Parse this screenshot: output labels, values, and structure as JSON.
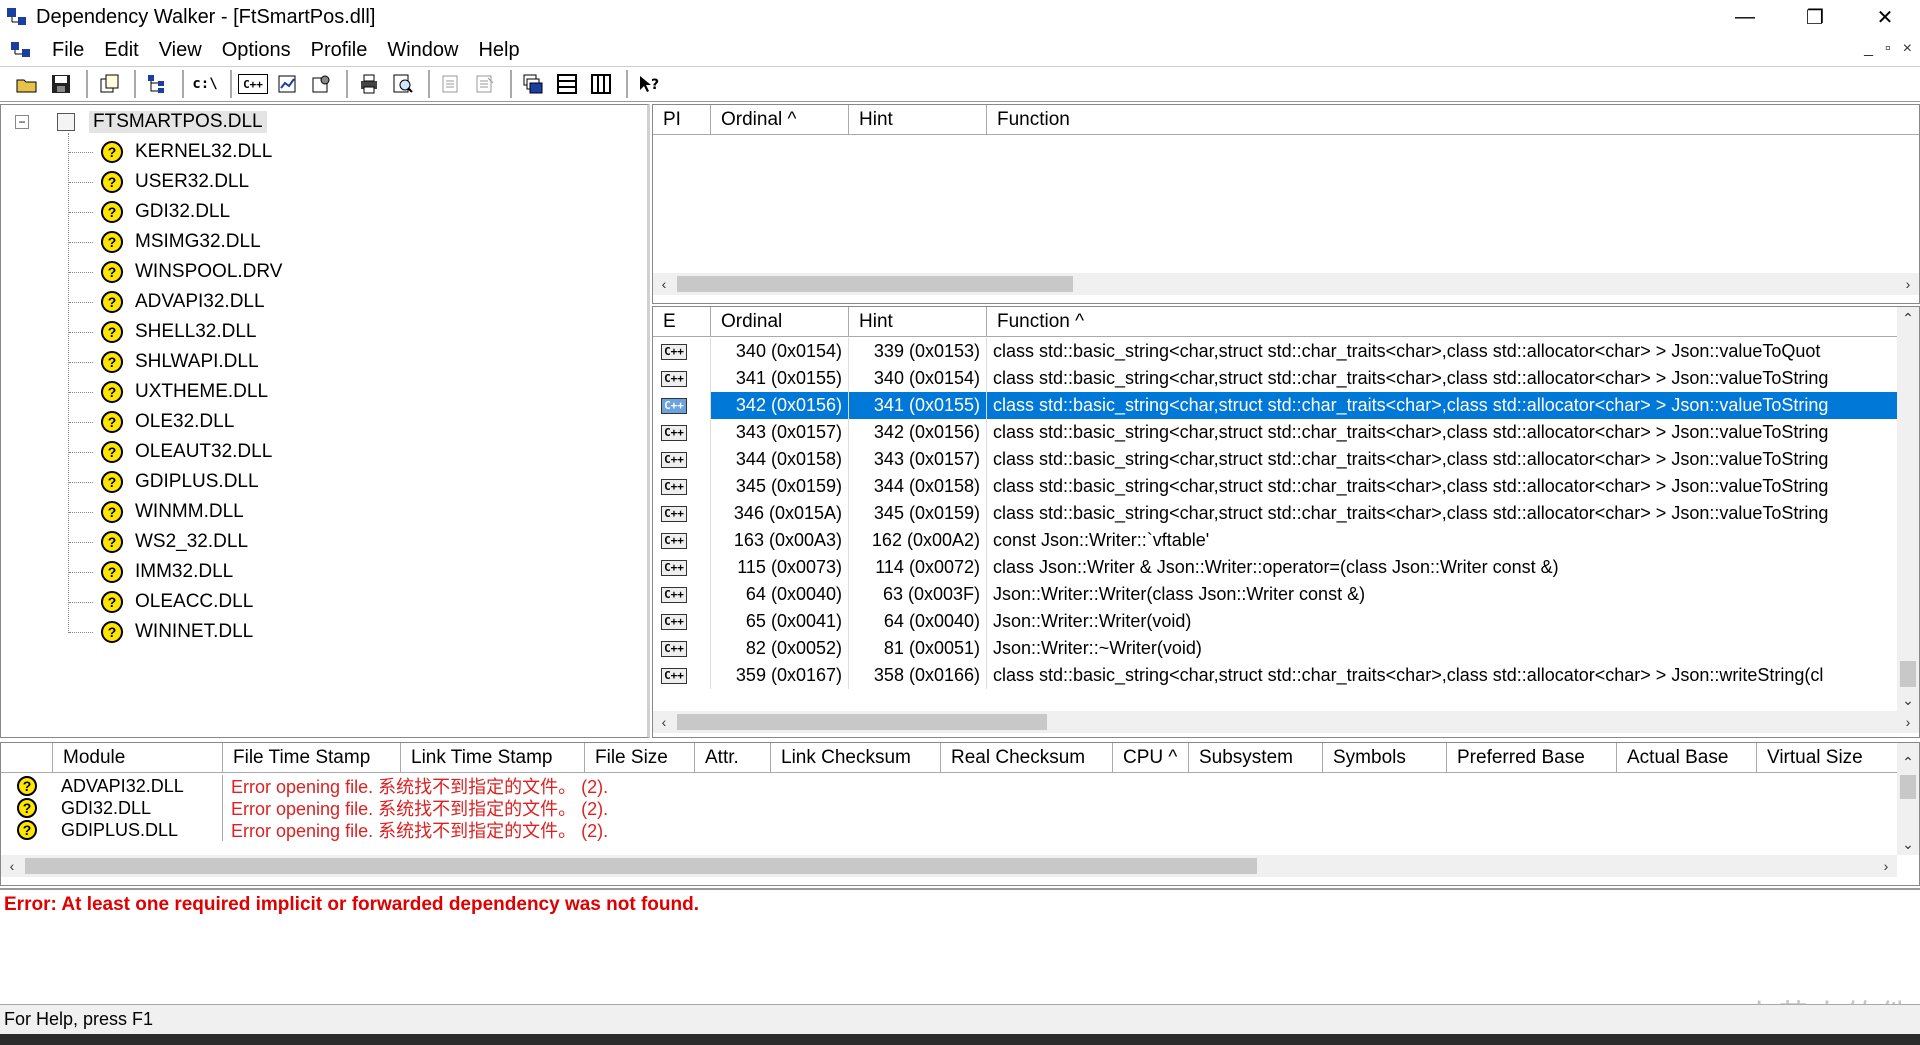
{
  "window": {
    "title": "Dependency Walker - [FtSmartPos.dll]",
    "minimize": "—",
    "maximize": "❐",
    "close": "✕"
  },
  "menu": {
    "items": [
      {
        "label": "File"
      },
      {
        "label": "Edit"
      },
      {
        "label": "View"
      },
      {
        "label": "Options"
      },
      {
        "label": "Profile"
      },
      {
        "label": "Window"
      },
      {
        "label": "Help"
      }
    ],
    "mdi_min": "_",
    "mdi_restore": "▫",
    "mdi_close": "×"
  },
  "toolbar": {
    "buttons": [
      "open-icon",
      "save-icon",
      "copy-icon",
      "tree-icon",
      "path-icon",
      "cpp-icon",
      "graph-icon",
      "properties-icon",
      "print-icon",
      "find-icon",
      "list1-icon",
      "list2-icon",
      "cascade-icon",
      "tile-h-icon",
      "tile-v-icon",
      "help-icon"
    ],
    "path_label": "c:\\",
    "cpp_label": "C++"
  },
  "tree": {
    "root": "FTSMARTPOS.DLL",
    "items": [
      "KERNEL32.DLL",
      "USER32.DLL",
      "GDI32.DLL",
      "MSIMG32.DLL",
      "WINSPOOL.DRV",
      "ADVAPI32.DLL",
      "SHELL32.DLL",
      "SHLWAPI.DLL",
      "UXTHEME.DLL",
      "OLE32.DLL",
      "OLEAUT32.DLL",
      "GDIPLUS.DLL",
      "WINMM.DLL",
      "WS2_32.DLL",
      "IMM32.DLL",
      "OLEACC.DLL",
      "WININET.DLL"
    ]
  },
  "imports": {
    "headers": [
      "PI",
      "Ordinal ^",
      "Hint",
      "Function"
    ]
  },
  "exports": {
    "headers": [
      "E",
      "Ordinal",
      "Hint",
      "Function ^"
    ],
    "rows": [
      {
        "ordinal": "340 (0x0154)",
        "hint": "339 (0x0153)",
        "function": "class std::basic_string<char,struct std::char_traits<char>,class std::allocator<char> > Json::valueToQuot"
      },
      {
        "ordinal": "341 (0x0155)",
        "hint": "340 (0x0154)",
        "function": "class std::basic_string<char,struct std::char_traits<char>,class std::allocator<char> > Json::valueToString"
      },
      {
        "ordinal": "342 (0x0156)",
        "hint": "341 (0x0155)",
        "function": "class std::basic_string<char,struct std::char_traits<char>,class std::allocator<char> > Json::valueToString"
      },
      {
        "ordinal": "343 (0x0157)",
        "hint": "342 (0x0156)",
        "function": "class std::basic_string<char,struct std::char_traits<char>,class std::allocator<char> > Json::valueToString"
      },
      {
        "ordinal": "344 (0x0158)",
        "hint": "343 (0x0157)",
        "function": "class std::basic_string<char,struct std::char_traits<char>,class std::allocator<char> > Json::valueToString"
      },
      {
        "ordinal": "345 (0x0159)",
        "hint": "344 (0x0158)",
        "function": "class std::basic_string<char,struct std::char_traits<char>,class std::allocator<char> > Json::valueToString"
      },
      {
        "ordinal": "346 (0x015A)",
        "hint": "345 (0x0159)",
        "function": "class std::basic_string<char,struct std::char_traits<char>,class std::allocator<char> > Json::valueToString"
      },
      {
        "ordinal": "163 (0x00A3)",
        "hint": "162 (0x00A2)",
        "function": "const Json::Writer::`vftable'"
      },
      {
        "ordinal": "115 (0x0073)",
        "hint": "114 (0x0072)",
        "function": "class Json::Writer & Json::Writer::operator=(class Json::Writer const &)"
      },
      {
        "ordinal": "64 (0x0040)",
        "hint": "63 (0x003F)",
        "function": "Json::Writer::Writer(class Json::Writer const &)"
      },
      {
        "ordinal": "65 (0x0041)",
        "hint": "64 (0x0040)",
        "function": "Json::Writer::Writer(void)"
      },
      {
        "ordinal": "82 (0x0052)",
        "hint": "81 (0x0051)",
        "function": "Json::Writer::~Writer(void)"
      },
      {
        "ordinal": "359 (0x0167)",
        "hint": "358 (0x0166)",
        "function": "class std::basic_string<char,struct std::char_traits<char>,class std::allocator<char> > Json::writeString(cl"
      }
    ],
    "selected_index": 2,
    "icon_label": "C++"
  },
  "modules": {
    "headers": [
      "Module",
      "File Time Stamp",
      "Link Time Stamp",
      "File Size",
      "Attr.",
      "Link Checksum",
      "Real Checksum",
      "CPU ^",
      "Subsystem",
      "Symbols",
      "Preferred Base",
      "Actual Base",
      "Virtual Size"
    ],
    "rows": [
      {
        "module": "ADVAPI32.DLL",
        "error": "Error opening file. 系统找不到指定的文件。 (2)."
      },
      {
        "module": "GDI32.DLL",
        "error": "Error opening file. 系统找不到指定的文件。 (2)."
      },
      {
        "module": "GDIPLUS.DLL",
        "error": "Error opening file. 系统找不到指定的文件。 (2)."
      }
    ]
  },
  "log": {
    "message": "Error: At least one required implicit or forwarded dependency was not found."
  },
  "status": {
    "text": "For Help, press F1"
  },
  "watermark": "CSDN @小黄人软件",
  "colors": {
    "selection": "#0078d7",
    "error": "#e02020",
    "question_icon": "#ffe600"
  }
}
